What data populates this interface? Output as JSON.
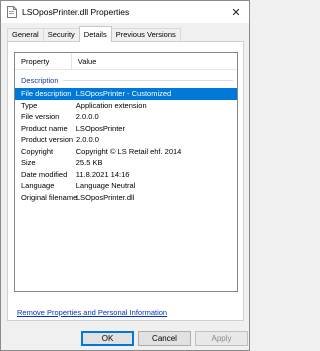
{
  "window": {
    "title": "LSOposPrinter.dll Properties",
    "close_glyph": "✕"
  },
  "tabs": [
    {
      "label": "General",
      "active": false
    },
    {
      "label": "Security",
      "active": false
    },
    {
      "label": "Details",
      "active": true
    },
    {
      "label": "Previous Versions",
      "active": false
    }
  ],
  "details": {
    "columns": {
      "property": "Property",
      "value": "Value"
    },
    "group": "Description",
    "rows": [
      {
        "key": "File description",
        "value": "LSOposPrinter - Customized",
        "selected": true
      },
      {
        "key": "Type",
        "value": "Application extension"
      },
      {
        "key": "File version",
        "value": "2.0.0.0"
      },
      {
        "key": "Product name",
        "value": "LSOposPrinter"
      },
      {
        "key": "Product version",
        "value": "2.0.0.0"
      },
      {
        "key": "Copyright",
        "value": "Copyright © LS Retail ehf. 2014"
      },
      {
        "key": "Size",
        "value": "25.5 KB"
      },
      {
        "key": "Date modified",
        "value": "11.8.2021 14:16"
      },
      {
        "key": "Language",
        "value": "Language Neutral"
      },
      {
        "key": "Original filename",
        "value": "LSOposPrinter.dll"
      }
    ]
  },
  "link": {
    "remove_properties": "Remove Properties and Personal Information"
  },
  "buttons": {
    "ok": "OK",
    "cancel": "Cancel",
    "apply": "Apply"
  },
  "colors": {
    "selection": "#0078d7",
    "link": "#0033cc",
    "group_header": "#133e9b"
  },
  "icons": {
    "title": "file-icon",
    "close": "close-icon"
  }
}
